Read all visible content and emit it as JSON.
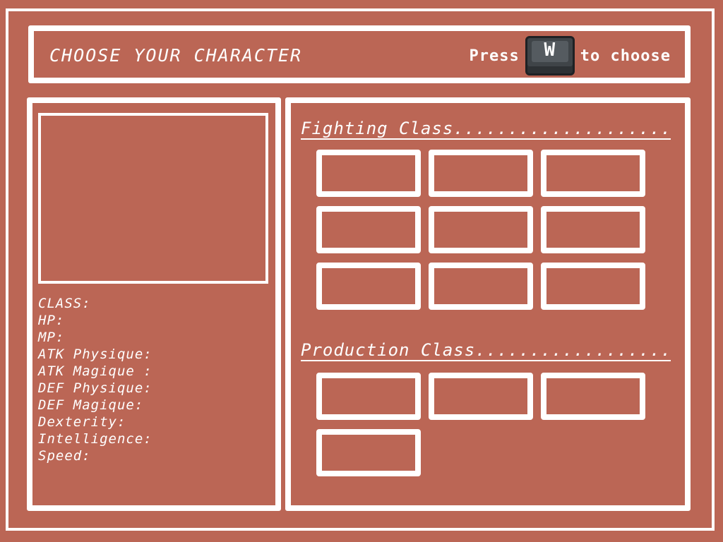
{
  "header": {
    "title": "CHOOSE YOUR CHARACTER",
    "press_label": "Press",
    "key_letter": "W",
    "choose_label": "to choose"
  },
  "stats": {
    "labels": [
      "CLASS:",
      "HP:",
      "MP:",
      "ATK Physique:",
      "ATK Magique :",
      "DEF Physique:",
      "DEF Magique:",
      "Dexterity:",
      "Intelligence:",
      "Speed:"
    ]
  },
  "sections": {
    "fighting": {
      "title": "Fighting Class",
      "slot_count": 9
    },
    "production": {
      "title": "Production Class",
      "slot_count": 4
    }
  },
  "colors": {
    "background": "#bb6655",
    "frame": "#ffffff",
    "key_icon": "#3f4448"
  },
  "icons": {
    "key": "w-key-icon"
  }
}
